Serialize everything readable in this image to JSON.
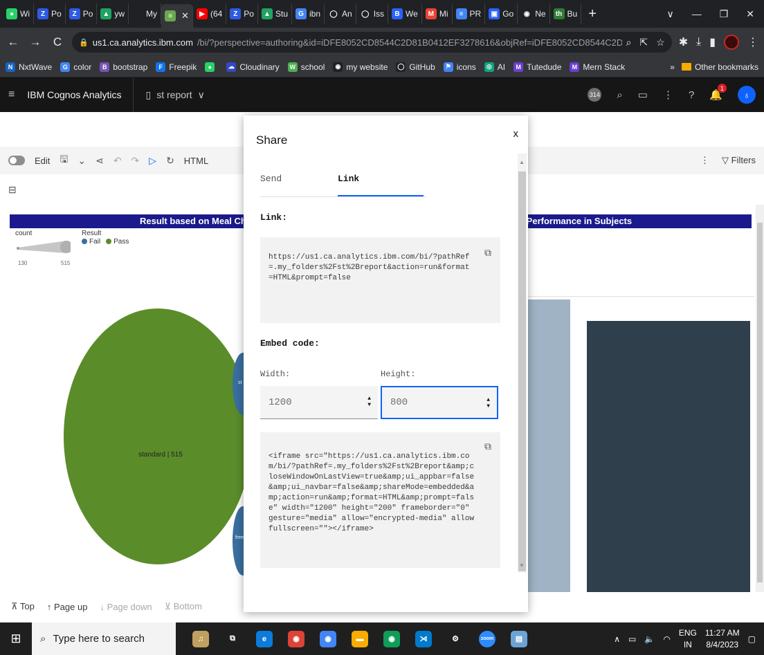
{
  "browser": {
    "tabs": [
      {
        "label": "Wi",
        "color": "#25d366",
        "glyph": "●"
      },
      {
        "label": "Po",
        "color": "#2d5be3",
        "glyph": "Z"
      },
      {
        "label": "Po",
        "color": "#2d5be3",
        "glyph": "Z"
      },
      {
        "label": "yw",
        "color": "#1fa463",
        "glyph": "▲"
      },
      {
        "label": "My",
        "color": "#202124",
        "glyph": ""
      },
      {
        "label": "",
        "color": "#6aa84f",
        "glyph": "≡",
        "active": true
      },
      {
        "label": "(64",
        "color": "#ff0000",
        "glyph": "▶"
      },
      {
        "label": "Po",
        "color": "#2d5be3",
        "glyph": "Z"
      },
      {
        "label": "Stu",
        "color": "#1fa463",
        "glyph": "▲"
      },
      {
        "label": "ibn",
        "color": "#4285f4",
        "glyph": "G"
      },
      {
        "label": "An",
        "color": "#202124",
        "glyph": "◯"
      },
      {
        "label": "Iss",
        "color": "#202124",
        "glyph": "◯"
      },
      {
        "label": "We",
        "color": "#2962ff",
        "glyph": "B"
      },
      {
        "label": "Mi",
        "color": "#ea4335",
        "glyph": "M"
      },
      {
        "label": "PR",
        "color": "#4285f4",
        "glyph": "≡"
      },
      {
        "label": "Go",
        "color": "#2962ff",
        "glyph": "▣"
      },
      {
        "label": "Ne",
        "color": "#202124",
        "glyph": "◉"
      },
      {
        "label": "Bu",
        "color": "#2e7d32",
        "glyph": "th"
      }
    ],
    "new_tab": "+",
    "url_host": "us1.ca.analytics.ibm.com",
    "url_rest": "/bi/?perspective=authoring&id=iDFE8052CD8544C2D81B0412EF3278616&objRef=iDFE8052CD8544C2D81B0412...",
    "bookmarks": [
      {
        "label": "NxtWave",
        "color": "#1565c0",
        "glyph": "N"
      },
      {
        "label": "color",
        "color": "#4285f4",
        "glyph": "G"
      },
      {
        "label": "bootstrap",
        "color": "#7952b3",
        "glyph": "B"
      },
      {
        "label": "Freepik",
        "color": "#1273eb",
        "glyph": "F"
      },
      {
        "label": "",
        "color": "#25d366",
        "glyph": "●"
      },
      {
        "label": "Cloudinary",
        "color": "#3448c5",
        "glyph": "☁"
      },
      {
        "label": "school",
        "color": "#4caf50",
        "glyph": "W"
      },
      {
        "label": "my website",
        "color": "#202124",
        "glyph": "◉"
      },
      {
        "label": "GitHub",
        "color": "#202124",
        "glyph": "◯"
      },
      {
        "label": "icons",
        "color": "#4285f4",
        "glyph": "⚑"
      },
      {
        "label": "AI",
        "color": "#10a37f",
        "glyph": "◎"
      },
      {
        "label": "Tutedude",
        "color": "#6a3fd1",
        "glyph": "M"
      },
      {
        "label": "Mern Stack",
        "color": "#6a3fd1",
        "glyph": "M"
      }
    ],
    "bookmarks_more": "»",
    "other_bookmarks": "Other bookmarks"
  },
  "app": {
    "brand": "IBM Cognos Analytics",
    "report_name": "st report",
    "badge_count": "314",
    "notification_count": "1",
    "toolbar": {
      "edit": "Edit",
      "html": "HTML",
      "filters": "Filters"
    }
  },
  "report": {
    "left_title": "Result based on Meal Choic",
    "right_title": "r Performance in Subjects",
    "legend_count": "count",
    "legend_result": "Result",
    "legend_fail": "Fail",
    "legend_pass": "Pass",
    "fail_color": "#3a6fa0",
    "pass_color": "#5b8c2a",
    "range_min": "130",
    "range_max": "515",
    "bubble_label": "standard | 515",
    "small_label_1": "st",
    "small_label_2": "free"
  },
  "pager": {
    "top": "Top",
    "page_up": "Page up",
    "page_down": "Page down",
    "bottom": "Bottom"
  },
  "share": {
    "title": "Share",
    "close": "x",
    "tab_send": "Send",
    "tab_link": "Link",
    "link_label": "Link:",
    "link_url": "https://us1.ca.analytics.ibm.com/bi/?pathRef=.my_folders%2Fst%2Breport&action=run&format=HTML&prompt=false",
    "embed_label": "Embed code:",
    "width_label": "Width:",
    "height_label": "Height:",
    "width_value": "1200",
    "height_value": "800",
    "embed_code": "<iframe src=\"https://us1.ca.analytics.ibm.com/bi/?pathRef=.my_folders%2Fst%2Breport&amp;closeWindowOnLastView=true&amp;ui_appbar=false&amp;ui_navbar=false&amp;shareMode=embedded&amp;action=run&amp;format=HTML&amp;prompt=false\" width=\"1200\" height=\"200\" frameborder=\"0\" gesture=\"media\" allow=\"encrypted-media\" allowfullscreen=\"\"></iframe>"
  },
  "taskbar": {
    "search_placeholder": "Type here to search",
    "lang_top": "ENG",
    "lang_bottom": "IN",
    "time": "11:27 AM",
    "date": "8/4/2023",
    "apps": [
      {
        "name": "trumpet-app",
        "color": "#c0a060",
        "glyph": "♫"
      },
      {
        "name": "task-view",
        "color": "#1f1f1f",
        "glyph": "⧉"
      },
      {
        "name": "edge-app",
        "color": "#0c7bdc",
        "glyph": "e"
      },
      {
        "name": "chrome-app",
        "color": "#db4437",
        "glyph": "◉"
      },
      {
        "name": "chrome-app-2",
        "color": "#4285f4",
        "glyph": "◉"
      },
      {
        "name": "file-explorer",
        "color": "#f9ab00",
        "glyph": "▬"
      },
      {
        "name": "chrome-app-3",
        "color": "#0f9d58",
        "glyph": "◉"
      },
      {
        "name": "vscode-app",
        "color": "#007acc",
        "glyph": "⋊"
      },
      {
        "name": "settings-app",
        "color": "#1f1f1f",
        "glyph": "⚙"
      },
      {
        "name": "zoom-app",
        "color": "#2d8cff",
        "glyph": "zoom"
      },
      {
        "name": "notepad-app",
        "color": "#6ba3d6",
        "glyph": "▤"
      }
    ]
  }
}
